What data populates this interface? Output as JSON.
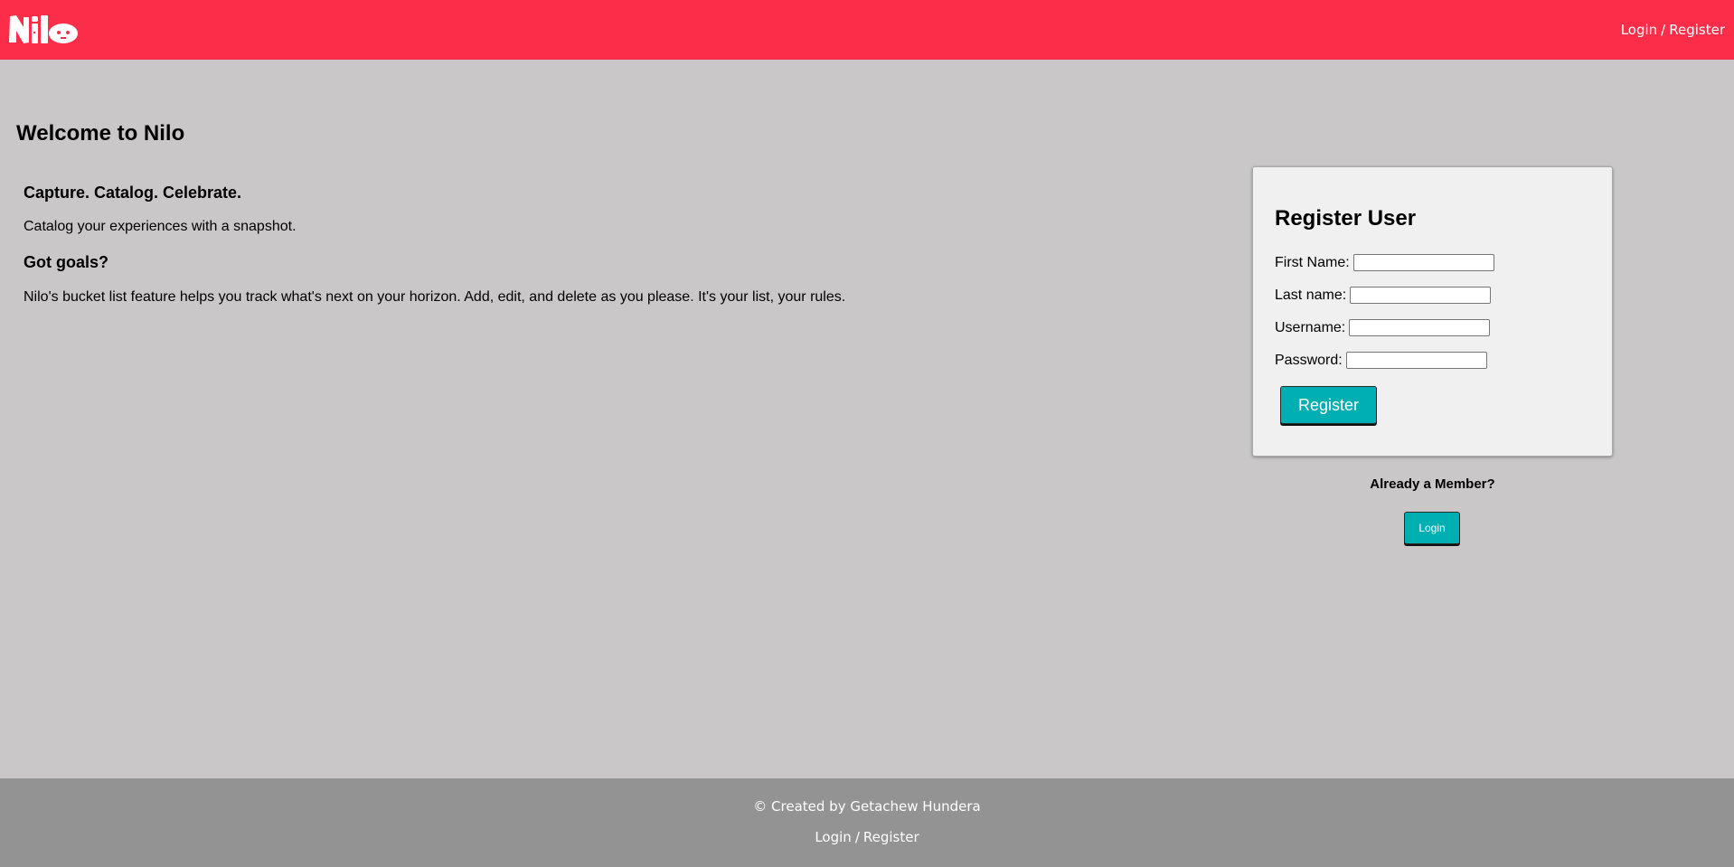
{
  "header": {
    "logo_text": "Nilo",
    "login_label": "Login",
    "separator": "/",
    "register_label": "Register",
    "background_color": "#fc2d49"
  },
  "main": {
    "title": "Welcome to Nilo",
    "tagline": "Capture. Catalog. Celebrate.",
    "tagline_text": "Catalog your experiences with a snapshot.",
    "goals_heading": "Got goals?",
    "goals_text": "Nilo's bucket list feature helps you track what's next on your horizon. Add, edit, and delete as you please. It's your list, your rules."
  },
  "register_form": {
    "title": "Register User",
    "first_name_label": "First Name:",
    "first_name_value": "",
    "last_name_label": "Last name:",
    "last_name_value": "",
    "username_label": "Username:",
    "username_value": "",
    "password_label": "Password:",
    "password_value": "",
    "submit_label": "Register",
    "button_color": "#00afb2"
  },
  "member_section": {
    "prompt": "Already a Member?",
    "login_button_label": "Login"
  },
  "footer": {
    "credit": "© Created by Getachew Hundera",
    "login_label": "Login",
    "separator": "/",
    "register_label": "Register",
    "background_color": "#939393"
  }
}
